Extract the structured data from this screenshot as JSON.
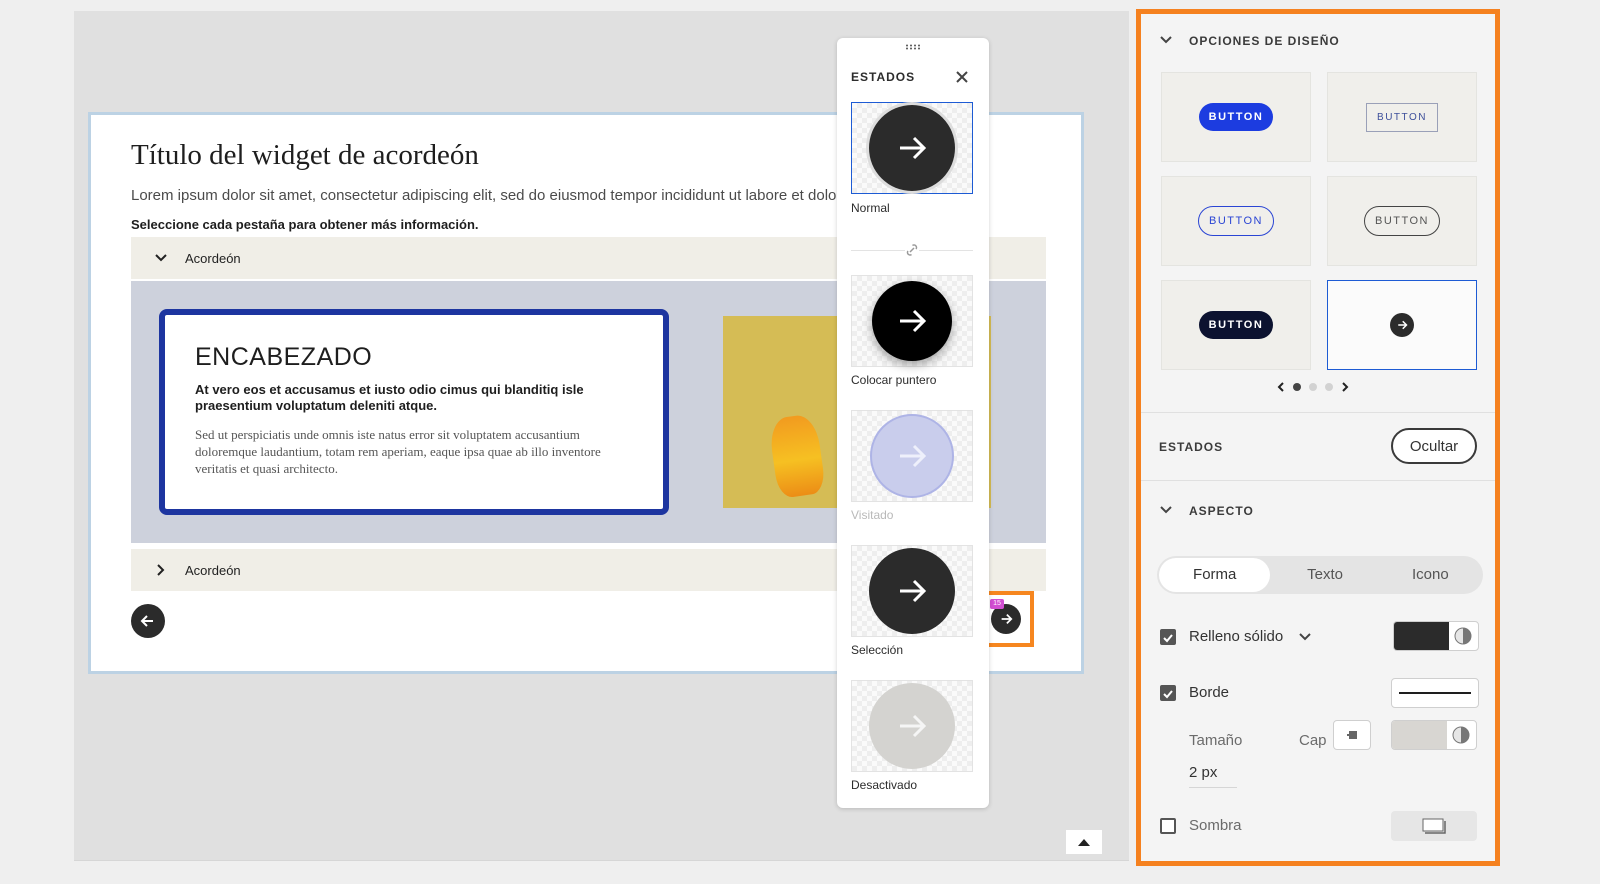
{
  "widget": {
    "title": "Título del widget de acordeón",
    "description": "Lorem ipsum dolor sit amet, consectetur adipiscing elit, sed do eiusmod tempor incididunt ut labore et dolore magna.",
    "instruction": "Seleccione cada pestaña para obtener más información.",
    "accordion_items": [
      "Acordeón",
      "Acordeón"
    ],
    "card": {
      "heading": "ENCABEZADO",
      "lead": "At vero eos et accusamus et iusto odio cimus qui blanditiq isle praesentium voluptatum deleniti atque.",
      "body": "Sed ut perspiciatis unde omnis iste natus error sit voluptatem accusantium doloremque laudantium, totam rem aperiam, eaque ipsa quae ab illo inventore veritatis et quasi architecto."
    },
    "selection_badge": "15"
  },
  "states_panel": {
    "title": "ESTADOS",
    "states": [
      {
        "label": "Normal",
        "color": "#2b2b2b"
      },
      {
        "label": "Colocar puntero",
        "color": "#000000"
      },
      {
        "label": "Visitado",
        "color": "#c9cdec"
      },
      {
        "label": "Selección",
        "color": "#2b2b2b"
      },
      {
        "label": "Desactivado",
        "color": "#d4d3d0"
      }
    ]
  },
  "design_panel": {
    "options_title": "OPCIONES DE DISEÑO",
    "button_label": "BUTTON",
    "states_title": "ESTADOS",
    "hide_label": "Ocultar",
    "aspect_title": "ASPECTO",
    "tabs": [
      "Forma",
      "Texto",
      "Icono"
    ],
    "solid_fill_label": "Relleno sólido",
    "border_label": "Borde",
    "size_label": "Tamaño",
    "cap_label": "Cap",
    "size_value": "2 px",
    "shadow_label": "Sombra",
    "fill_color": "#2b2b2b",
    "border_color": "#1e1e1e",
    "accent": "#f5811f"
  }
}
